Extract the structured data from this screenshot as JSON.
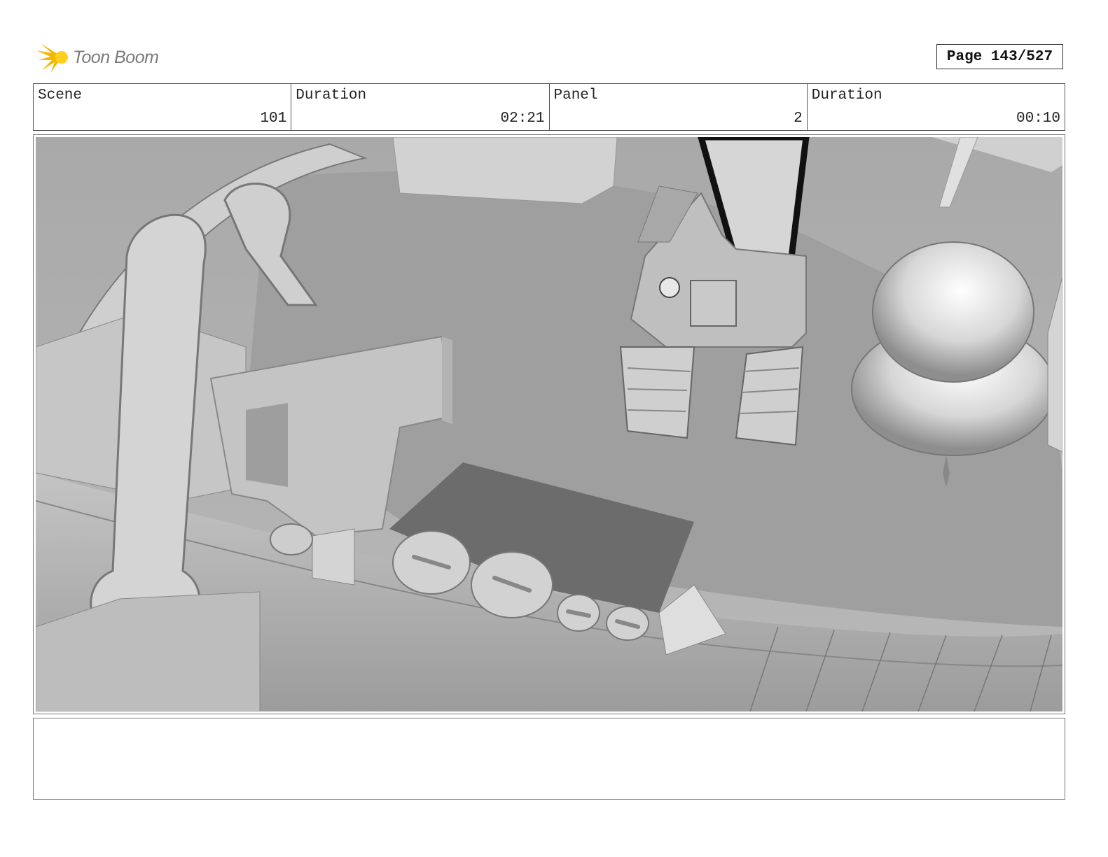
{
  "header": {
    "logo_text": "Toon Boom",
    "page_label": "Page 143/527"
  },
  "info": {
    "scene_label": "Scene",
    "scene_value": "101",
    "scene_duration_label": "Duration",
    "scene_duration_value": "02:21",
    "panel_label": "Panel",
    "panel_value": "2",
    "panel_duration_label": "Duration",
    "panel_duration_value": "00:10"
  },
  "notes": {
    "text": ""
  },
  "colors": {
    "logo_star": "#f5b800",
    "logo_text": "#7a7a7a",
    "border": "#555555"
  }
}
